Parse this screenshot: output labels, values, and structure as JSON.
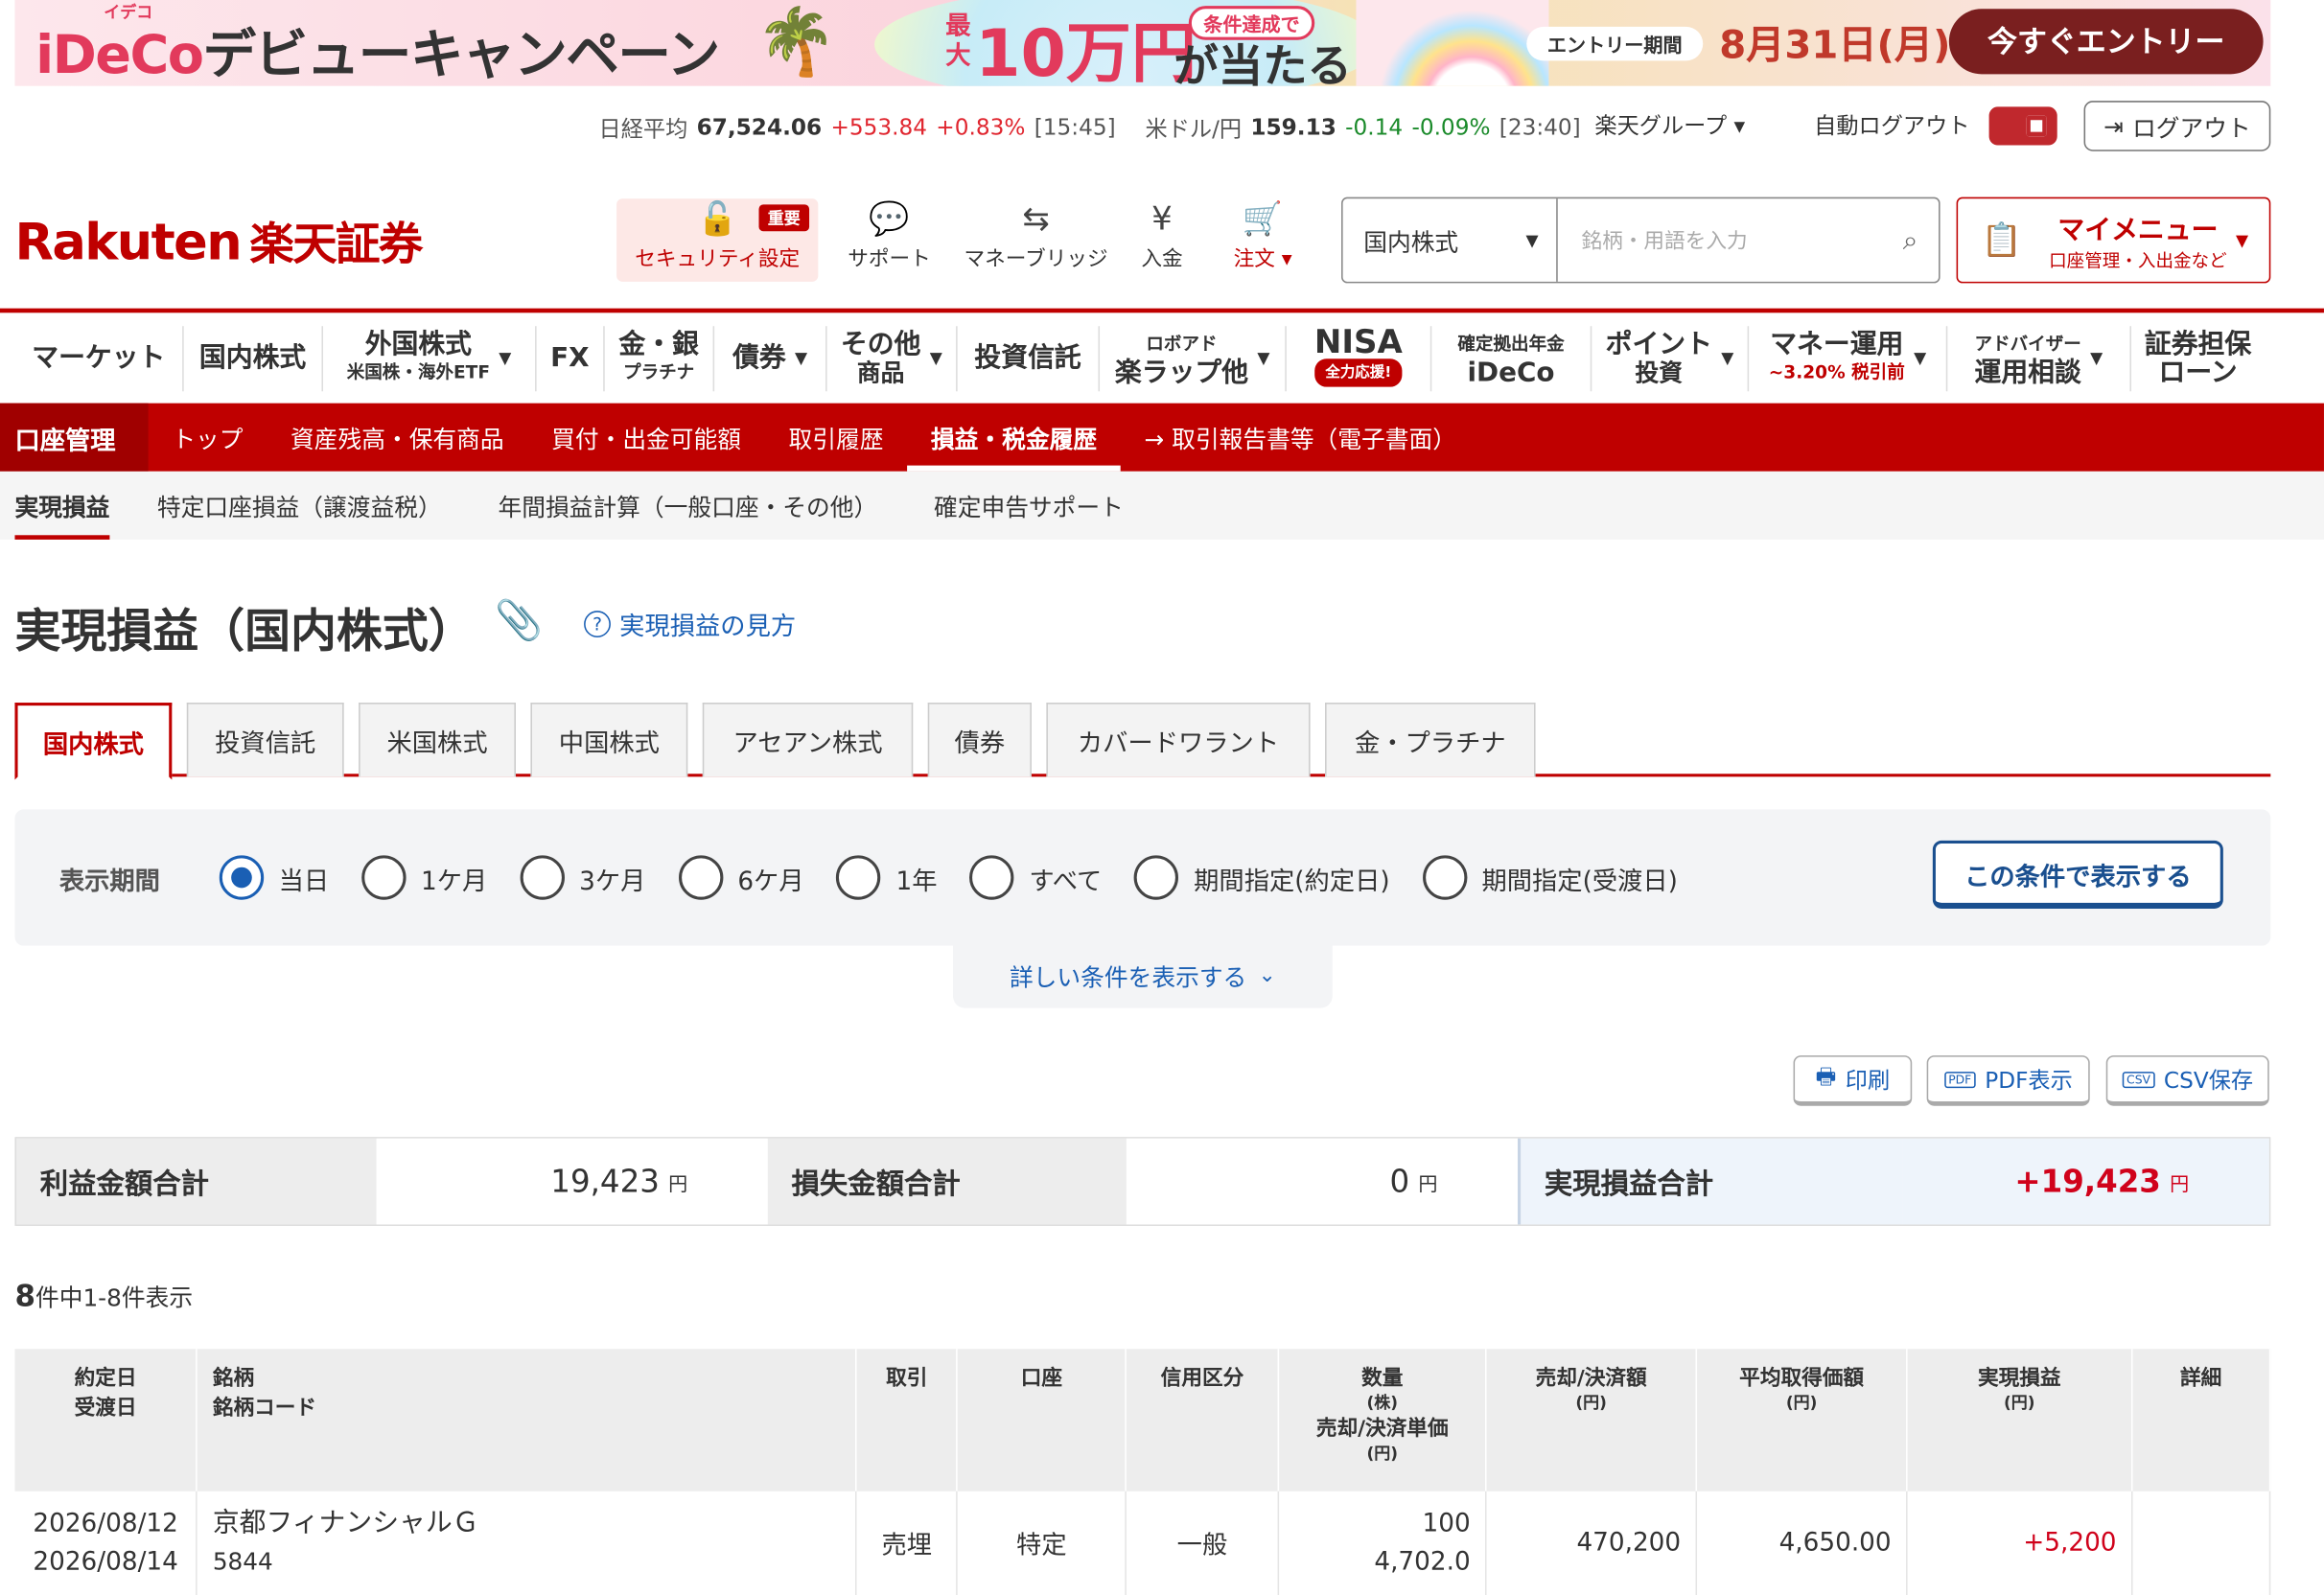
{
  "banner": {
    "ruby": "イデコ",
    "title_a": "iDeCo",
    "title_b": "デビューキャンペーン",
    "max": "最大",
    "amount": "10万円",
    "condition": "条件達成で",
    "hit": "が当たる",
    "entry_period": "エントリー期間",
    "date": "8月31日(月)まで",
    "button": "今すぐエントリー"
  },
  "ticker": {
    "nikkei_label": "日経平均",
    "nikkei_value": "67,524.06",
    "nikkei_change": "+553.84",
    "nikkei_pct": "+0.83%",
    "nikkei_time": "[15:45]",
    "usd_label": "米ドル/円",
    "usd_value": "159.13",
    "usd_change": "-0.14",
    "usd_pct": "-0.09%",
    "usd_time": "[23:40]",
    "group": "楽天グループ ▾",
    "auto_logout": "自動ログアウト",
    "logout": "ログアウト"
  },
  "header": {
    "logo": "Rakuten",
    "logo_jp": "楽天証券",
    "security": "セキュリティ設定",
    "security_badge": "重要",
    "support": "サポート",
    "moneybridge": "マネーブリッジ",
    "deposit": "入金",
    "order": "注文 ▾",
    "search_select": "国内株式",
    "search_placeholder": "銘柄・用語を入力",
    "mymenu_title": "マイメニュー",
    "mymenu_sub": "口座管理・入出金など"
  },
  "gnav": [
    {
      "label": "マーケット",
      "sub": ""
    },
    {
      "label": "国内株式",
      "sub": ""
    },
    {
      "label": "外国株式",
      "sub": "米国株・海外ETF"
    },
    {
      "label": "FX",
      "sub": ""
    },
    {
      "label": "金・銀",
      "sub": "プラチナ"
    },
    {
      "label": "債券",
      "sub": ""
    },
    {
      "label": "その他",
      "sub": "商品"
    },
    {
      "label": "投資信託",
      "sub": ""
    },
    {
      "label": "ロボアド",
      "sub": "楽ラップ他"
    },
    {
      "label": "NISA",
      "sub": "全力応援!"
    },
    {
      "label": "確定拠出年金",
      "sub": "iDeCo"
    },
    {
      "label": "ポイント",
      "sub": "投資"
    },
    {
      "label": "マネー運用",
      "sub": "~3.20% 税引前"
    },
    {
      "label": "アドバイザー",
      "sub": "運用相談"
    },
    {
      "label": "証券担保",
      "sub": "ローン"
    }
  ],
  "rnav": {
    "head": "口座管理",
    "items": [
      "トップ",
      "資産残高・保有商品",
      "買付・出金可能額",
      "取引履歴",
      "損益・税金履歴",
      "→ 取引報告書等（電子書面）"
    ]
  },
  "tnav": [
    "実現損益",
    "特定口座損益（譲渡益税）",
    "年間損益計算（一般口座・その他）",
    "確定申告サポート"
  ],
  "page": {
    "title": "実現損益（国内株式）",
    "howto": "実現損益の見方"
  },
  "ptabs": [
    "国内株式",
    "投資信託",
    "米国株式",
    "中国株式",
    "アセアン株式",
    "債券",
    "カバードワラント",
    "金・プラチナ"
  ],
  "filter": {
    "label": "表示期間",
    "options": [
      "当日",
      "1ケ月",
      "3ケ月",
      "6ケ月",
      "1年",
      "すべて",
      "期間指定(約定日)",
      "期間指定(受渡日)"
    ],
    "selected": "当日",
    "apply": "この条件で表示する",
    "more": "詳しい条件を表示する"
  },
  "actions": {
    "print": "印刷",
    "pdf": "PDF表示",
    "csv": "CSV保存"
  },
  "summary": {
    "profit_label": "利益金額合計",
    "profit_value": "19,423",
    "loss_label": "損失金額合計",
    "loss_value": "0",
    "realized_label": "実現損益合計",
    "realized_value": "+19,423",
    "unit": "円"
  },
  "count": {
    "total": "8",
    "text": "件中1-8件表示"
  },
  "table": {
    "headers": {
      "date1": "約定日",
      "date2": "受渡日",
      "name1": "銘柄",
      "name2": "銘柄コード",
      "trade": "取引",
      "account": "口座",
      "margin": "信用区分",
      "qty": "数量",
      "qty_unit": "(株)",
      "unit_price": "売却/決済単価",
      "unit_price_unit": "(円)",
      "amount": "売却/決済額",
      "amount_unit": "(円)",
      "avg": "平均取得価額",
      "avg_unit": "(円)",
      "pl": "実現損益",
      "pl_unit": "(円)",
      "detail": "詳細"
    },
    "rows": [
      {
        "trade_date": "2026/08/12",
        "settle_date": "2026/08/14",
        "name": "京都フィナンシャルＧ",
        "code": "5844",
        "trade": "売埋",
        "account": "特定",
        "margin": "一般",
        "qty": "100",
        "price": "4,702.0",
        "amount": "470,200",
        "avg": "4,650.00",
        "pl": "+5,200"
      }
    ]
  }
}
